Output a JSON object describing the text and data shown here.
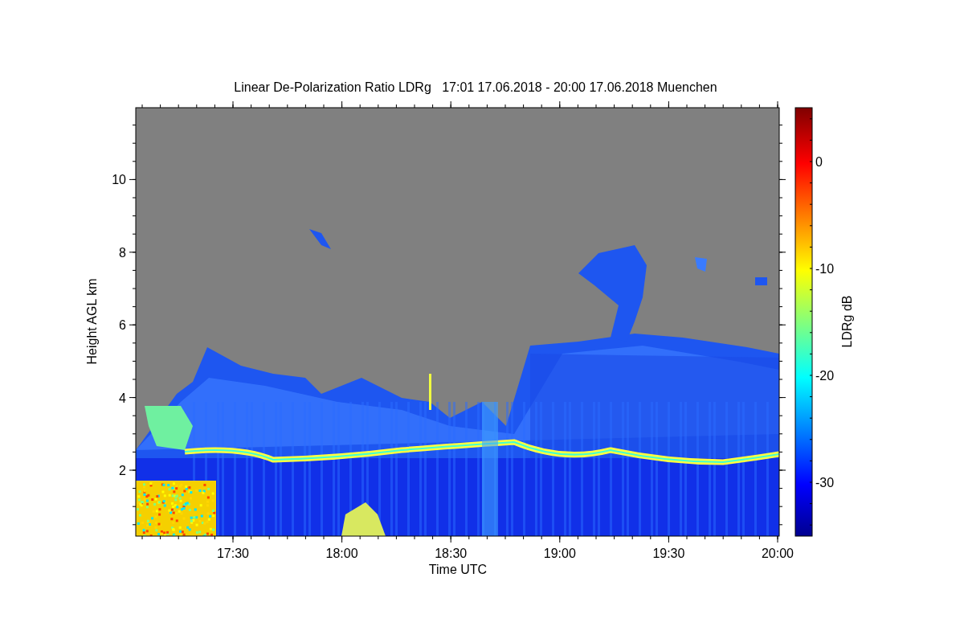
{
  "title": "Linear De-Polarization Ratio LDRg   17:01 17.06.2018 - 20:00 17.06.2018 Muenchen",
  "y_axis": {
    "label": "Height AGL km",
    "ticks": [
      "10",
      "8",
      "6",
      "4",
      "2"
    ]
  },
  "x_axis": {
    "label": "Time UTC",
    "ticks": [
      "17:30",
      "18:00",
      "18:30",
      "19:00",
      "19:30",
      "20:00"
    ]
  },
  "colorbar": {
    "label": "LDRg dB",
    "ticks": [
      "0",
      "-10",
      "-20",
      "-30"
    ]
  }
}
